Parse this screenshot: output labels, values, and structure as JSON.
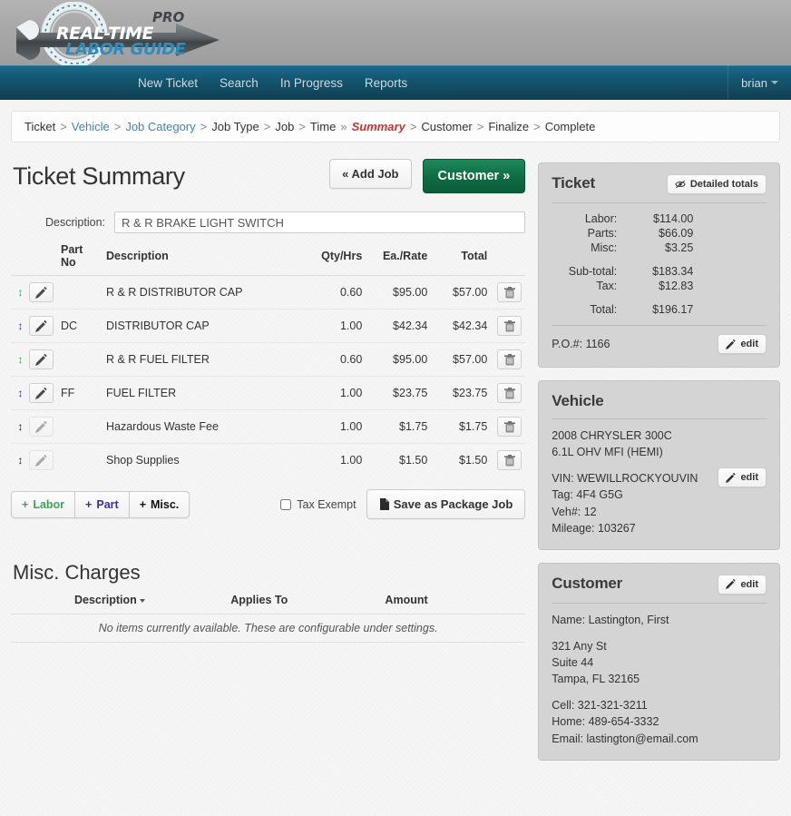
{
  "brand": {
    "name_line1": "REAL-TIME",
    "name_line2": "LABOR GUIDE",
    "badge": "PRO"
  },
  "nav": {
    "items": [
      {
        "label": "New Ticket"
      },
      {
        "label": "Search"
      },
      {
        "label": "In Progress"
      },
      {
        "label": "Reports"
      }
    ],
    "user": "brian"
  },
  "breadcrumb": {
    "items": [
      {
        "label": "Ticket",
        "state": "plain",
        "sep": ">"
      },
      {
        "label": "Vehicle",
        "state": "link",
        "sep": ">"
      },
      {
        "label": "Job Category",
        "state": "link",
        "sep": ">"
      },
      {
        "label": "Job Type",
        "state": "plain",
        "sep": ">"
      },
      {
        "label": "Job",
        "state": "plain",
        "sep": ">"
      },
      {
        "label": "Time",
        "state": "plain",
        "sep": "»"
      },
      {
        "label": "Summary",
        "state": "current",
        "sep": ">"
      },
      {
        "label": "Customer",
        "state": "plain",
        "sep": ">"
      },
      {
        "label": "Finalize",
        "state": "plain",
        "sep": ">"
      },
      {
        "label": "Complete",
        "state": "plain",
        "sep": ""
      }
    ]
  },
  "main": {
    "title": "Ticket Summary",
    "add_job_label": "« Add Job",
    "customer_label": "Customer »",
    "description_label": "Description:",
    "description_value": "R & R BRAKE LIGHT SWITCH",
    "columns": {
      "part_no": "Part No",
      "description": "Description",
      "qty": "Qty/Hrs",
      "rate": "Ea./Rate",
      "total": "Total"
    },
    "rows": [
      {
        "kind": "labor",
        "part_no": "",
        "description": "R & R DISTRIBUTOR CAP",
        "qty": "0.60",
        "rate": "$95.00",
        "total": "$57.00",
        "edit_enabled": true
      },
      {
        "kind": "part",
        "part_no": "DC",
        "description": "DISTRIBUTOR CAP",
        "qty": "1.00",
        "rate": "$42.34",
        "total": "$42.34",
        "edit_enabled": true
      },
      {
        "kind": "labor",
        "part_no": "",
        "description": "R & R FUEL FILTER",
        "qty": "0.60",
        "rate": "$95.00",
        "total": "$57.00",
        "edit_enabled": true
      },
      {
        "kind": "part",
        "part_no": "FF",
        "description": "FUEL FILTER",
        "qty": "1.00",
        "rate": "$23.75",
        "total": "$23.75",
        "edit_enabled": true
      },
      {
        "kind": "misc",
        "part_no": "",
        "description": "Hazardous Waste Fee",
        "qty": "1.00",
        "rate": "$1.75",
        "total": "$1.75",
        "edit_enabled": false
      },
      {
        "kind": "misc",
        "part_no": "",
        "description": "Shop Supplies",
        "qty": "1.00",
        "rate": "$1.50",
        "total": "$1.50",
        "edit_enabled": false
      }
    ],
    "add_labor_label": "Labor",
    "add_part_label": "Part",
    "add_misc_label": "Misc.",
    "plus": "+",
    "tax_exempt_label": "Tax Exempt",
    "tax_exempt_checked": false,
    "save_package_label": "Save as Package Job"
  },
  "misc_charges": {
    "title": "Misc. Charges",
    "columns": {
      "description": "Description",
      "applies_to": "Applies To",
      "amount": "Amount"
    },
    "empty_message": "No items currently available. These are configurable under settings."
  },
  "ticket_panel": {
    "title": "Ticket",
    "detailed_totals_label": "Detailed totals",
    "lines": [
      {
        "label": "Labor:",
        "value": "$114.00",
        "style": "labor"
      },
      {
        "label": "Parts:",
        "value": "$66.09",
        "style": "parts"
      },
      {
        "label": "Misc:",
        "value": "$3.25",
        "style": "misc"
      }
    ],
    "subtotal_label": "Sub-total:",
    "subtotal_value": "$183.34",
    "tax_label": "Tax:",
    "tax_value": "$12.83",
    "total_label": "Total:",
    "total_value": "$196.17",
    "po_label": "P.O.#: 1166",
    "edit_label": "edit"
  },
  "vehicle_panel": {
    "title": "Vehicle",
    "line1": "2008 CHRYSLER 300C",
    "line2": "6.1L OHV MFI (HEMI)",
    "vin": "VIN: WEWILLROCKYOUVIN",
    "tag": "Tag: 4F4 G5G",
    "veh_no": "Veh#: 12",
    "mileage": "Mileage: 103267",
    "edit_label": "edit"
  },
  "customer_panel": {
    "title": "Customer",
    "edit_label": "edit",
    "name": "Name: Lastington, First",
    "address1": "321 Any St",
    "address2": "Suite 44",
    "address3": "Tampa, FL 32165",
    "cell": "Cell: 321-321-3211",
    "home": "Home: 489-654-3332",
    "email": "Email: lastington@email.com"
  },
  "colors": {
    "labor_green": "#3aa757",
    "parts_blue": "#3b2fa0",
    "accent_green": "#0d6b42",
    "nav_blue": "#14566f",
    "current_crumb_red": "#d2322d"
  }
}
